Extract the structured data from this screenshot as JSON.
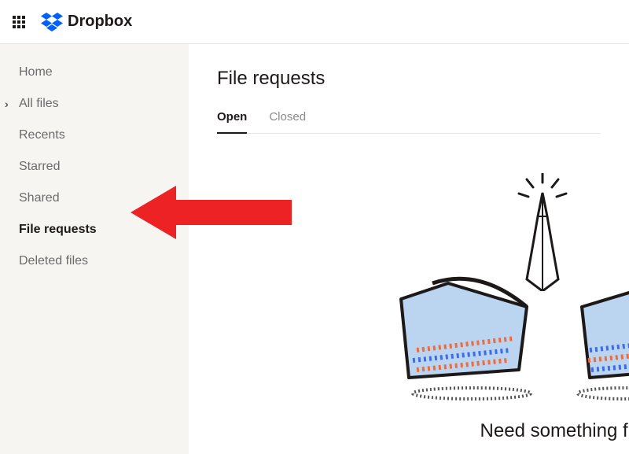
{
  "header": {
    "logo_text": "Dropbox"
  },
  "sidebar": {
    "items": [
      {
        "label": "Home",
        "active": false,
        "expandable": false
      },
      {
        "label": "All files",
        "active": false,
        "expandable": true
      },
      {
        "label": "Recents",
        "active": false,
        "expandable": false
      },
      {
        "label": "Starred",
        "active": false,
        "expandable": false
      },
      {
        "label": "Shared",
        "active": false,
        "expandable": false
      },
      {
        "label": "File requests",
        "active": true,
        "expandable": false
      },
      {
        "label": "Deleted files",
        "active": false,
        "expandable": false
      }
    ]
  },
  "main": {
    "title": "File requests",
    "tabs": [
      {
        "label": "Open",
        "active": true
      },
      {
        "label": "Closed",
        "active": false
      }
    ],
    "empty_heading": "Need something from"
  },
  "annotation": {
    "arrow_color": "#ED2224"
  }
}
